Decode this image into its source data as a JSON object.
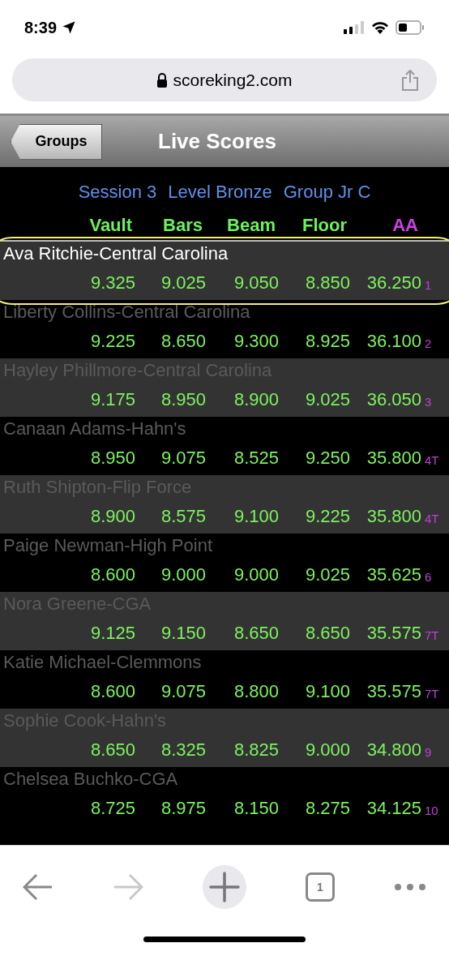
{
  "status_bar": {
    "time": "8:39"
  },
  "browser": {
    "url": "scoreking2.com",
    "tab_count": "1"
  },
  "nav": {
    "back_label": "Groups",
    "title": "Live Scores"
  },
  "group_info": [
    "Session 3",
    "Level Bronze",
    "Group Jr C"
  ],
  "columns": [
    {
      "label": "Vault",
      "kind": "event"
    },
    {
      "label": "Bars",
      "kind": "event"
    },
    {
      "label": "Beam",
      "kind": "event"
    },
    {
      "label": "Floor",
      "kind": "event"
    },
    {
      "label": "AA",
      "kind": "total"
    }
  ],
  "rows": [
    {
      "name": "Ava Ritchie-Central Carolina",
      "obscured": false,
      "circled": true,
      "scores": [
        "9.325",
        "9.025",
        "9.050",
        "8.850",
        "36.250"
      ],
      "rank": "1"
    },
    {
      "name": "Liberty Collins-Central Carolina",
      "obscured": true,
      "circled": false,
      "scores": [
        "9.225",
        "8.650",
        "9.300",
        "8.925",
        "36.100"
      ],
      "rank": "2"
    },
    {
      "name": "Hayley Phillmore-Central Carolina",
      "obscured": true,
      "circled": false,
      "scores": [
        "9.175",
        "8.950",
        "8.900",
        "9.025",
        "36.050"
      ],
      "rank": "3"
    },
    {
      "name": "Canaan Adams-Hahn's",
      "obscured": true,
      "circled": false,
      "scores": [
        "8.950",
        "9.075",
        "8.525",
        "9.250",
        "35.800"
      ],
      "rank": "4T"
    },
    {
      "name": "Ruth Shipton-Flip Force",
      "obscured": true,
      "circled": false,
      "scores": [
        "8.900",
        "8.575",
        "9.100",
        "9.225",
        "35.800"
      ],
      "rank": "4T"
    },
    {
      "name": "Paige Newman-High Point",
      "obscured": true,
      "circled": false,
      "scores": [
        "8.600",
        "9.000",
        "9.000",
        "9.025",
        "35.625"
      ],
      "rank": "6"
    },
    {
      "name": "Nora Greene-CGA",
      "obscured": true,
      "circled": false,
      "scores": [
        "9.125",
        "9.150",
        "8.650",
        "8.650",
        "35.575"
      ],
      "rank": "7T"
    },
    {
      "name": "Katie Michael-Clemmons",
      "obscured": true,
      "circled": false,
      "scores": [
        "8.600",
        "9.075",
        "8.800",
        "9.100",
        "35.575"
      ],
      "rank": "7T"
    },
    {
      "name": "Sophie Cook-Hahn's",
      "obscured": true,
      "circled": false,
      "scores": [
        "8.650",
        "8.325",
        "8.825",
        "9.000",
        "34.800"
      ],
      "rank": "9"
    },
    {
      "name": "Chelsea Buchko-CGA",
      "obscured": true,
      "circled": false,
      "scores": [
        "8.725",
        "8.975",
        "8.150",
        "8.275",
        "34.125"
      ],
      "rank": "10"
    }
  ]
}
